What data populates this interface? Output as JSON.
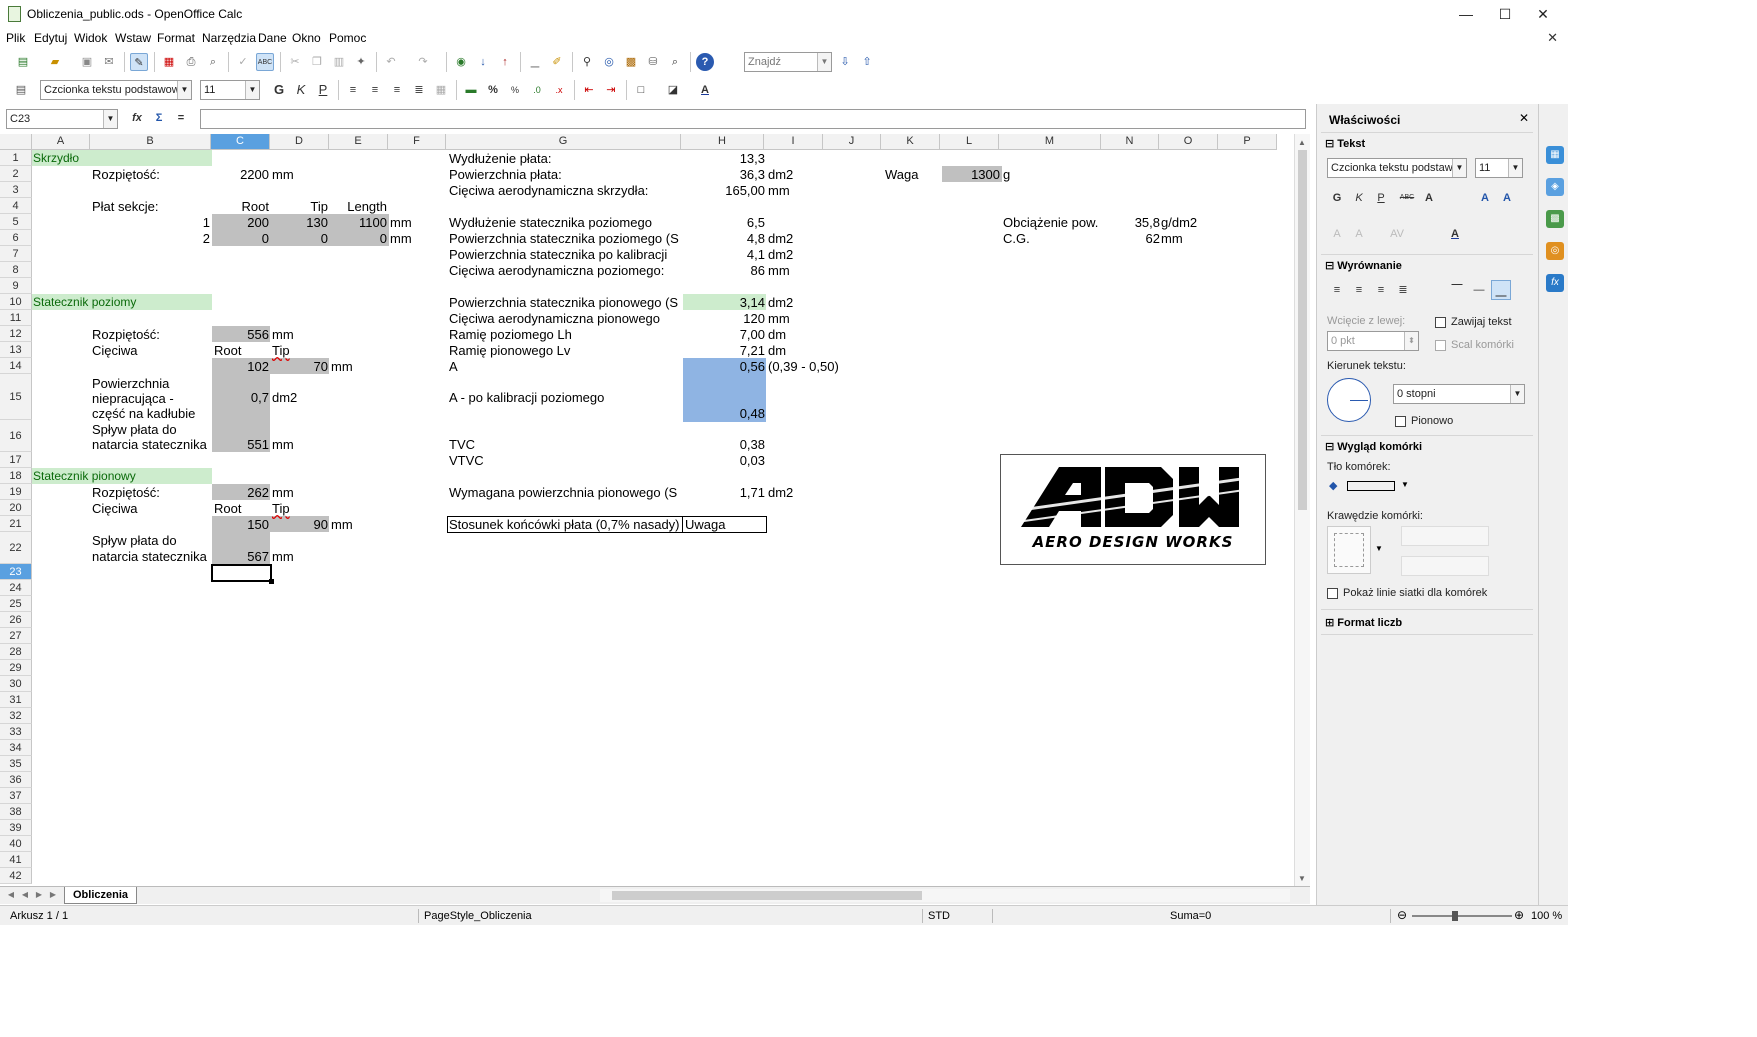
{
  "window": {
    "title": "Obliczenia_public.ods - OpenOffice Calc",
    "minimize": "—",
    "maximize": "☐",
    "close": "✕"
  },
  "menu": [
    "Plik",
    "Edytuj",
    "Widok",
    "Wstaw",
    "Format",
    "Narzędzia",
    "Dane",
    "Okno",
    "Pomoc"
  ],
  "toolbar": {
    "find_placeholder": "Znajdź",
    "font_name": "Czcionka tekstu podstawow",
    "font_size": "11",
    "bold": "G",
    "italic": "K",
    "underline": "P",
    "percent": "%"
  },
  "formula_bar": {
    "name_box": "C23",
    "func_wizard": "fx",
    "sum": "Σ",
    "equals": "=",
    "content": ""
  },
  "sheet": {
    "columns": [
      "A",
      "B",
      "C",
      "D",
      "E",
      "F",
      "G",
      "H",
      "I",
      "J",
      "K",
      "L",
      "M",
      "N",
      "O",
      "P"
    ],
    "selected_column": "C",
    "selected_row": "23",
    "cells": {
      "A1": "Skrzydło",
      "B2": "Rozpiętość:",
      "C2": "2200",
      "D2": "mm",
      "B4": "Płat sekcje:",
      "C4": "Root",
      "D4": "Tip",
      "E4": "Length",
      "B5": "1",
      "C5": "200",
      "D5": "130",
      "E5": "1100",
      "F5": "mm",
      "B6": "2",
      "C6": "0",
      "D6": "0",
      "E6": "0",
      "F6": "mm",
      "A10": "Statecznik poziomy",
      "B12": "Rozpiętość:",
      "C12": "556",
      "D12": "mm",
      "B13": "Cięciwa",
      "C13": "Root",
      "D13": "Tip",
      "C14": "102",
      "D14": "70",
      "E14": "mm",
      "B15a": "Powierzchnia",
      "B15b": "niepracująca -",
      "B15c": "część na kadłubie",
      "C15": "0,7",
      "D15": "dm2",
      "B16a": "Spływ płata do",
      "B16b": "natarcia statecznika",
      "C16": "551",
      "D16": "mm",
      "A18": "Statecznik pionowy",
      "B19": "Rozpiętość:",
      "C19": "262",
      "D19": "mm",
      "B20": "Cięciwa",
      "C20": "Root",
      "D20": "Tip",
      "C21": "150",
      "D21": "90",
      "E21": "mm",
      "B22a": "Spływ płata do",
      "B22b": "natarcia statecznika",
      "C22": "567",
      "D22": "mm",
      "G1": "Wydłużenie płata:",
      "H1": "13,3",
      "G2": "Powierzchnia płata:",
      "H2": "36,3",
      "I2": "dm2",
      "G3": "Cięciwa aerodynamiczna skrzydła:",
      "H3": "165,00",
      "I3": "mm",
      "G5": "Wydłużenie statecznika poziomego",
      "H5": "6,5",
      "G6": "Powierzchnia statecznika poziomego (S",
      "H6": "4,8",
      "I6": "dm2",
      "G7": "Powierzchnia statecznika po kalibracji",
      "H7": "4,1",
      "I7": "dm2",
      "G8": "Cięciwa aerodynamiczna poziomego:",
      "H8": "86",
      "I8": "mm",
      "G10": "Powierzchnia statecznika pionowego (S",
      "H10": "3,14",
      "I10": "dm2",
      "G11": "Cięciwa aerodynamiczna pionowego",
      "H11": "120",
      "I11": "mm",
      "G12": "Ramię poziomego Lh",
      "H12": "7,00",
      "I12": "dm",
      "G13": "Ramię pionowego Lv",
      "H13": "7,21",
      "I13": "dm",
      "G14": "A",
      "H14": "0,56",
      "I14": "(0,39 - 0,50)",
      "G15": "A - po kalibracji poziomego",
      "H15": "0,48",
      "G16": "TVC",
      "H16": "0,38",
      "G17": "VTVC",
      "H17": "0,03",
      "G19": "Wymagana powierzchnia pionowego (S",
      "H19": "1,71",
      "I19": "dm2",
      "G21": "Stosunek końcówki płata (0,7% nasady)",
      "H21": "Uwaga",
      "K2": "Waga",
      "L2": "1300",
      "M2": "g",
      "M5": "Obciążenie pow.",
      "N5": "35,8",
      "O5": "g/dm2",
      "M6": "C.G.",
      "N6": "62",
      "O6": "mm"
    },
    "logo_text": "AERO DESIGN WORKS",
    "logo_mark": "ADW"
  },
  "sheet_tabs": [
    "Obliczenia"
  ],
  "status": {
    "sheet": "Arkusz 1 / 1",
    "page_style": "PageStyle_Obliczenia",
    "mode": "STD",
    "sum": "Suma=0",
    "zoom": "100 %"
  },
  "sidebar": {
    "title": "Właściwości",
    "text_section": "Tekst",
    "font_name": "Czcionka tekstu podstawo",
    "font_size": "11",
    "align_section": "Wyrównanie",
    "indent_label": "Wcięcie z lewej:",
    "indent_value": "0 pkt",
    "wrap_text": "Zawijaj tekst",
    "merge_cells": "Scal komórki",
    "direction_label": "Kierunek tekstu:",
    "direction_value": "0 stopni",
    "vertical": "Pionowo",
    "cell_look_section": "Wygląd komórki",
    "background_label": "Tło komórek:",
    "borders_label": "Krawędzie komórki:",
    "show_grid": "Pokaż linie siatki dla komórek",
    "number_format_section": "Format liczb"
  },
  "colors": {
    "selection": "#5aa0e0",
    "grey_cell": "#c0c0c0",
    "green_cell": "#cdeccd",
    "blue_cell": "#8fb4e3"
  }
}
